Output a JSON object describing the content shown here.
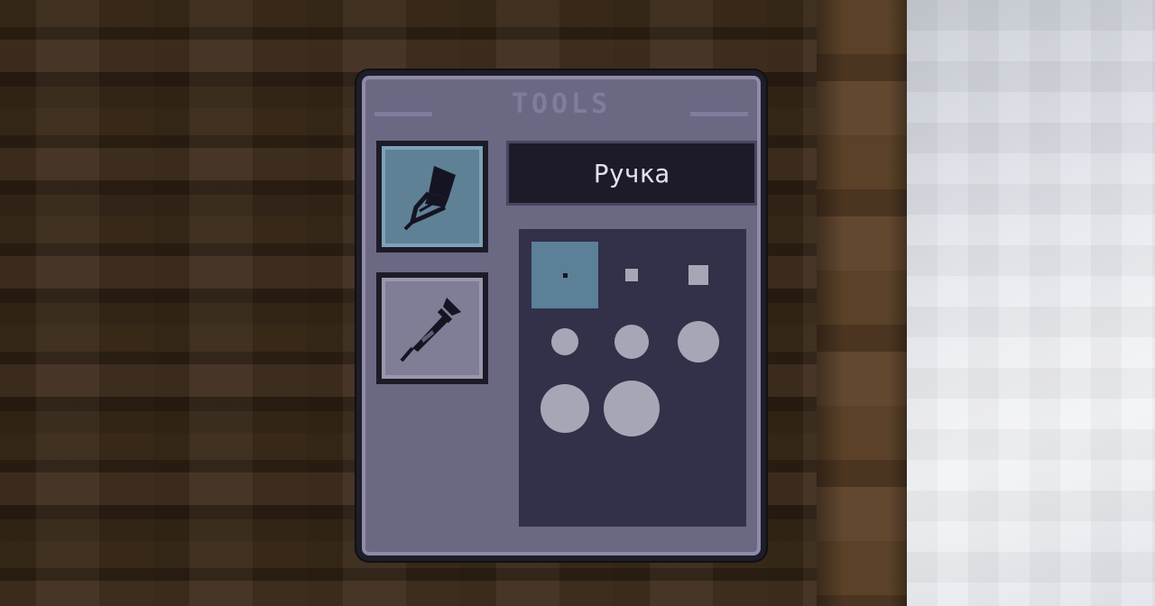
{
  "panel": {
    "title": "TOOLS",
    "selected_tool_label": "Ручка"
  },
  "tools": [
    {
      "name": "pen",
      "icon": "pen-icon",
      "active": true
    },
    {
      "name": "pipette",
      "icon": "pipette-icon",
      "active": false
    }
  ],
  "brush_sizes": [
    {
      "size": 1,
      "selected": true
    },
    {
      "size": 2,
      "selected": false
    },
    {
      "size": 3,
      "selected": false
    },
    {
      "size": 4,
      "selected": false
    },
    {
      "size": 5,
      "selected": false
    },
    {
      "size": 6,
      "selected": false
    },
    {
      "size": 7,
      "selected": false
    },
    {
      "size": 8,
      "selected": false
    }
  ],
  "colors": {
    "panel_bg": "#6b6884",
    "active_tool": "#5f8196",
    "size_panel_bg": "#33304a",
    "label_bg": "#1d1b29"
  }
}
